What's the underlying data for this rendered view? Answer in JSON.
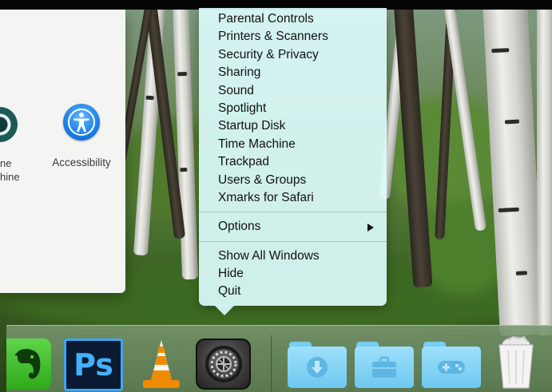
{
  "preferences_window": {
    "partial_icon_label_lines": [
      "ne",
      "hine"
    ],
    "accessibility_label": "Accessibility"
  },
  "context_menu": {
    "app_items": [
      "Parental Controls",
      "Printers & Scanners",
      "Security & Privacy",
      "Sharing",
      "Sound",
      "Spotlight",
      "Startup Disk",
      "Time Machine",
      "Trackpad",
      "Users & Groups",
      "Xmarks for Safari"
    ],
    "options_label": "Options",
    "window_items": [
      "Show All Windows",
      "Hide",
      "Quit"
    ]
  },
  "dock": {
    "apps": [
      {
        "name": "Evernote",
        "icon": "evernote-elephant-icon",
        "color": "#2fa91b"
      },
      {
        "name": "Photoshop",
        "icon": "photoshop-icon",
        "text": "Ps",
        "color": "#43b1ff"
      },
      {
        "name": "VLC",
        "icon": "vlc-cone-icon",
        "color": "#f08a00"
      },
      {
        "name": "System Preferences",
        "icon": "gear-icon",
        "color": "#3a3a3a"
      }
    ],
    "folders": [
      {
        "name": "Downloads",
        "icon": "download-arrow-icon"
      },
      {
        "name": "Applications",
        "icon": "briefcase-icon"
      },
      {
        "name": "Games",
        "icon": "gamepad-icon"
      }
    ],
    "trash": {
      "icon": "trash-full-icon"
    }
  }
}
